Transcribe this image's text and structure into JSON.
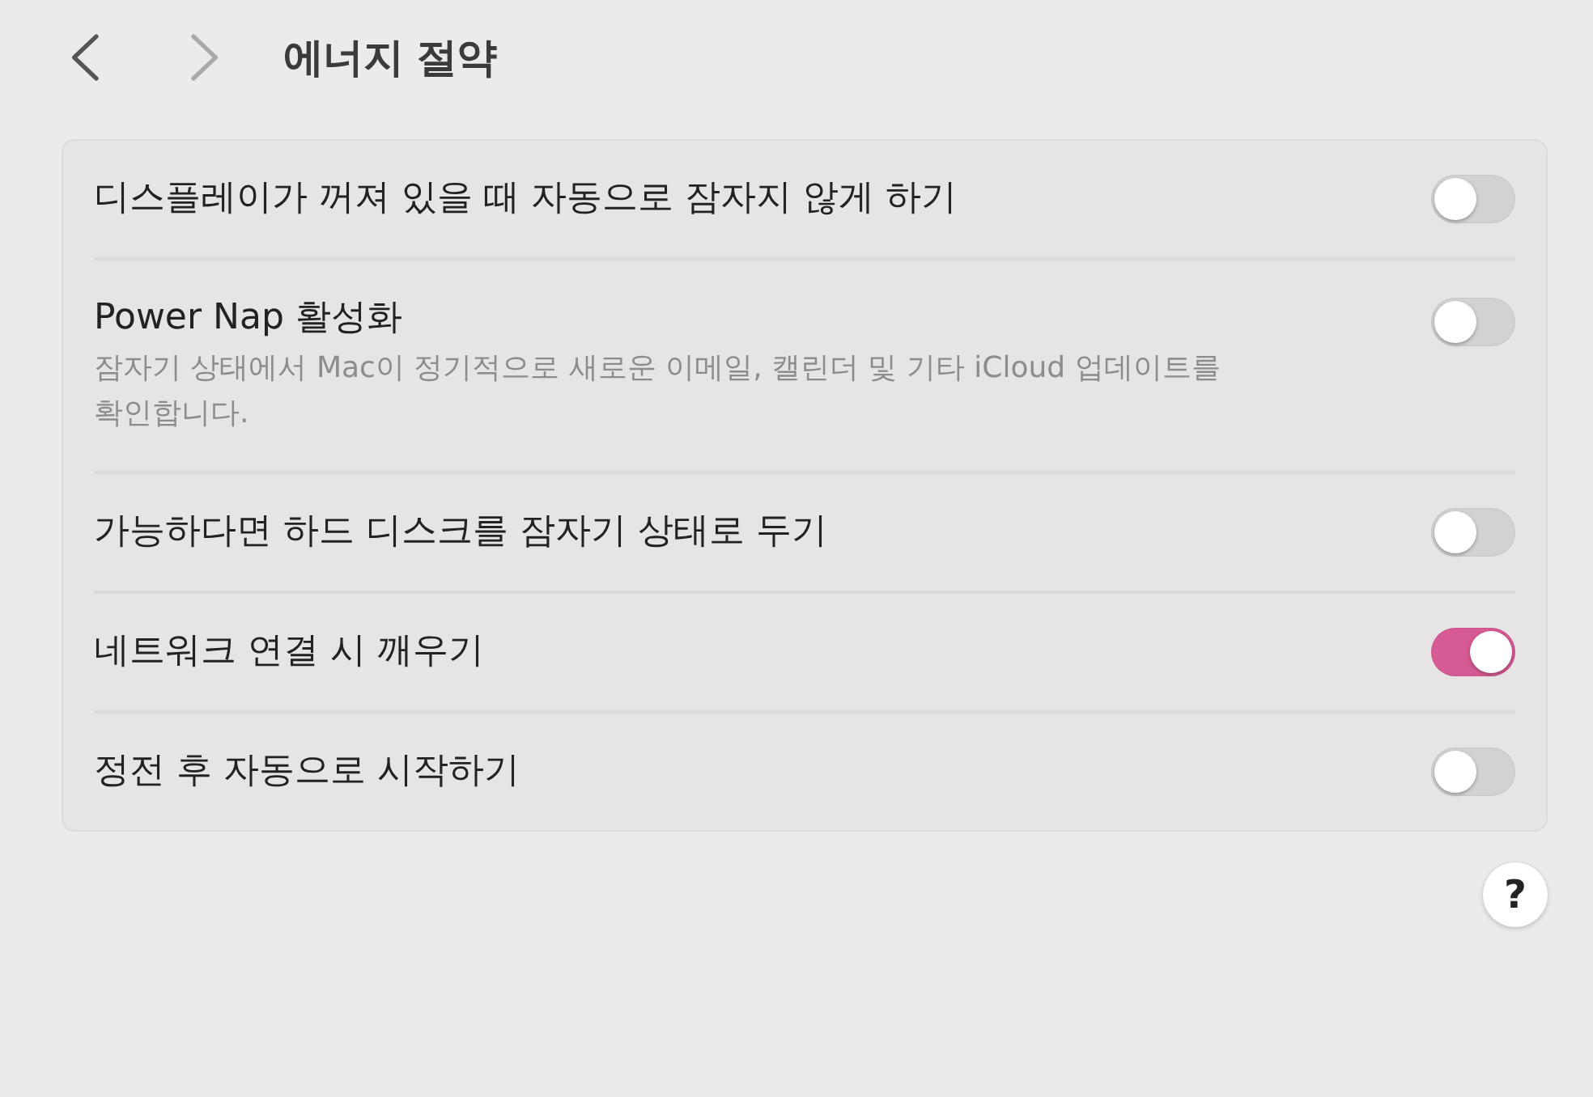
{
  "navigation": {
    "back": {
      "disabled": false
    },
    "forward": {
      "disabled": true
    }
  },
  "title": "에너지 절약",
  "rows": [
    {
      "label": "디스플레이가 꺼져 있을 때 자동으로 잠자지 않게 하기",
      "on": false
    },
    {
      "label": "Power Nap 활성화",
      "description": "잠자기 상태에서 Mac이 정기적으로 새로운 이메일, 캘린더 및 기타 iCloud 업데이트를 확인합니다.",
      "on": false
    },
    {
      "label": "가능하다면 하드 디스크를 잠자기 상태로 두기",
      "on": false
    },
    {
      "label": "네트워크 연결 시 깨우기",
      "on": true
    },
    {
      "label": "정전 후 자동으로 시작하기",
      "on": false
    }
  ],
  "help_button": {
    "label": "?"
  }
}
